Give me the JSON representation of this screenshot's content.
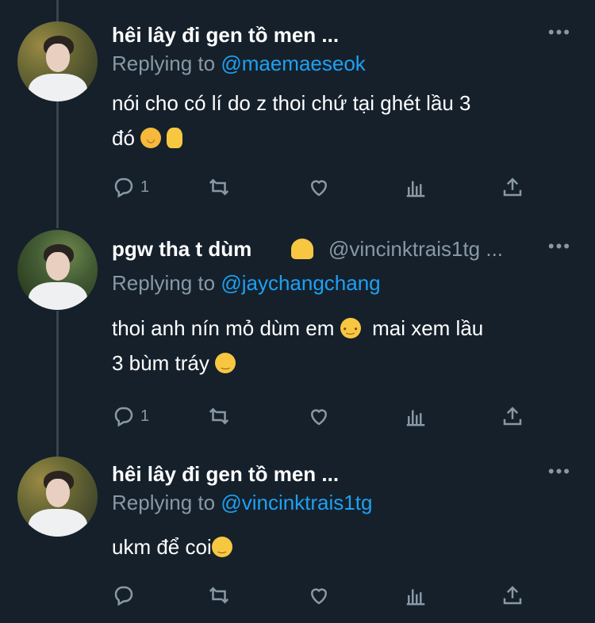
{
  "colors": {
    "background": "#15202b",
    "text": "#ffffff",
    "muted": "#8899a6",
    "link": "#1da1f2",
    "thread": "#38444d"
  },
  "tweets": [
    {
      "name": "hêi lây đi gen tồ men ...",
      "handle": "",
      "more": "•••",
      "reply_prefix": "Replying to",
      "reply_handle": "@maemaeseok",
      "text_line1": "nói cho có lí do z thoi chứ tại ghét lầu 3",
      "text_line2": "đó",
      "emojis": [
        "smirking-cat-emoji",
        "victory-hand-emoji"
      ],
      "reply_count": "1",
      "avatar": "avatar-autumn"
    },
    {
      "name": "pgw tha t dùm",
      "handle": "@vincinktrais1tg ...",
      "more": "•••",
      "reply_prefix": "Replying to",
      "reply_handle": "@jaychangchang",
      "text_line1": "thoi anh nín mỏ dùm em",
      "text_line1b": "mai xem lầu",
      "text_line2": "3 bùm tráy",
      "emojis": [
        "folded-hands-emoji",
        "shushing-face-emoji",
        "smirking-face-emoji"
      ],
      "reply_count": "1",
      "avatar": "avatar-garden"
    },
    {
      "name": "hêi lây đi gen tồ men ...",
      "handle": "",
      "more": "•••",
      "reply_prefix": "Replying to",
      "reply_handle": "@vincinktrais1tg",
      "text_line1": "ukm để coi",
      "emojis": [
        "smirking-face-emoji"
      ],
      "reply_count": "",
      "avatar": "avatar-autumn"
    }
  ]
}
